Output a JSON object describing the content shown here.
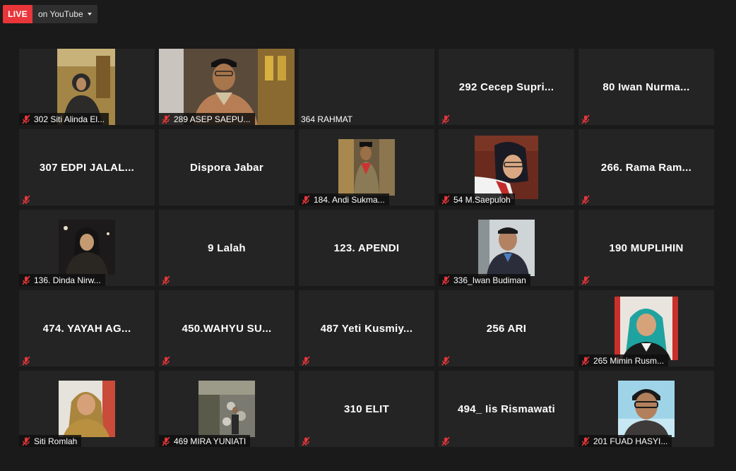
{
  "header": {
    "live_label": "LIVE",
    "youtube_label": "on YouTube"
  },
  "colors": {
    "live_red": "#e8363a",
    "tile_bg": "#242424",
    "muted_mic": "#e8363a"
  },
  "participants": [
    {
      "name": "302 Siti Alinda El...",
      "video": true
    },
    {
      "name": "289 ASEP SAEPU...",
      "video": true
    },
    {
      "name": "364 RAHMAT",
      "video": false,
      "muted_icon": false
    },
    {
      "name": "292 Cecep Supri...",
      "video": false
    },
    {
      "name": "80 Iwan Nurma...",
      "video": false
    },
    {
      "name": "307 EDPI JALAL...",
      "video": false
    },
    {
      "name": "Dispora Jabar",
      "video": false,
      "muted_icon": false
    },
    {
      "name": "184. Andi Sukma...",
      "video": true
    },
    {
      "name": "54 M.Saepuloh",
      "video": true
    },
    {
      "name": "266. Rama Ram...",
      "video": false
    },
    {
      "name": "136. Dinda Nirw...",
      "video": true
    },
    {
      "name": "9 Lalah",
      "video": false
    },
    {
      "name": "123. APENDI",
      "video": false,
      "muted_icon": false
    },
    {
      "name": "336_Iwan Budiman",
      "video": true
    },
    {
      "name": "190 MUPLIHIN",
      "video": false
    },
    {
      "name": "474. YAYAH AG...",
      "video": false
    },
    {
      "name": "450.WAHYU SU...",
      "video": false
    },
    {
      "name": "487 Yeti Kusmiy...",
      "video": false
    },
    {
      "name": "256 ARI",
      "video": false
    },
    {
      "name": "265 Mimin Rusm...",
      "video": true
    },
    {
      "name": "Siti Romlah",
      "video": true
    },
    {
      "name": "469 MIRA YUNIATI",
      "video": true
    },
    {
      "name": "310 ELIT",
      "video": false
    },
    {
      "name": "494_ Iis Rismawati",
      "video": false
    },
    {
      "name": "201 FUAD HASYI...",
      "video": true
    }
  ]
}
